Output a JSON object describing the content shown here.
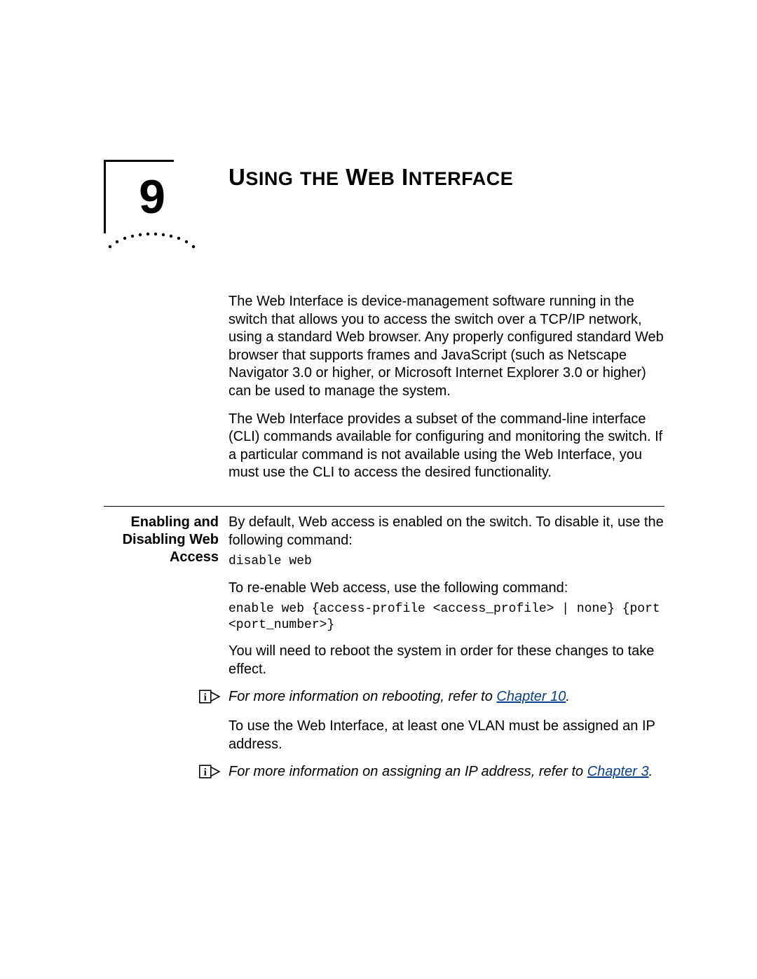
{
  "chapter": {
    "number": "9",
    "title_main": "U",
    "title_rest1": "SING",
    "title_sp1": " ",
    "title_rest2": "THE",
    "title_sp2": " W",
    "title_rest3": "EB",
    "title_sp3": " I",
    "title_rest4": "NTERFACE"
  },
  "intro": {
    "p1": "The Web Interface is device-management software running in the switch that allows you to access the switch over a TCP/IP network, using a standard Web browser. Any properly configured standard Web browser that supports frames and JavaScript (such as Netscape Navigator 3.0 or higher, or Microsoft Internet Explorer 3.0 or higher) can be used to manage the system.",
    "p2": "The Web Interface provides a subset of the command-line interface (CLI) commands available for configuring and monitoring the switch. If a particular command is not available using the Web Interface, you must use the CLI to access the desired functionality."
  },
  "section1": {
    "heading_l1": "Enabling and",
    "heading_l2": "Disabling Web",
    "heading_l3": "Access",
    "p1": "By default, Web access is enabled on the switch. To disable it, use the following command:",
    "code1": "disable web",
    "p2": "To re-enable Web access, use the following command:",
    "code2": "enable web {access-profile <access_profile> | none} {port <port_number>}",
    "p3": "You will need to reboot the system in order for these changes to take effect.",
    "note1_prefix": "For more information on rebooting, refer to ",
    "note1_link": "Chapter 10",
    "note1_suffix": ".",
    "p4": "To use the Web Interface, at least one VLAN must be assigned an IP address.",
    "note2_prefix": "For more information on assigning an IP address, refer to ",
    "note2_link": "Chapter 3",
    "note2_suffix": "."
  }
}
